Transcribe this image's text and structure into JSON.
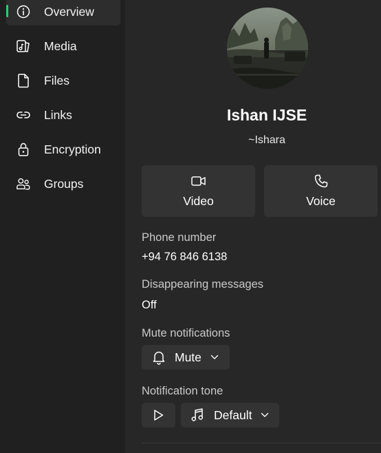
{
  "sidebar": {
    "items": [
      {
        "label": "Overview",
        "icon": "info-icon"
      },
      {
        "label": "Media",
        "icon": "media-icon"
      },
      {
        "label": "Files",
        "icon": "file-icon"
      },
      {
        "label": "Links",
        "icon": "link-icon"
      },
      {
        "label": "Encryption",
        "icon": "lock-icon"
      },
      {
        "label": "Groups",
        "icon": "groups-icon"
      }
    ],
    "active": "Overview"
  },
  "profile": {
    "name": "Ishan IJSE",
    "subname": "~Ishara"
  },
  "actions": {
    "video_label": "Video",
    "voice_label": "Voice"
  },
  "phone": {
    "label": "Phone number",
    "value": "+94 76 846 6138"
  },
  "disappearing": {
    "label": "Disappearing messages",
    "value": "Off"
  },
  "mute": {
    "label": "Mute notifications",
    "button_label": "Mute"
  },
  "tone": {
    "label": "Notification tone",
    "select_label": "Default"
  },
  "colors": {
    "accent": "#25d366",
    "sidebar_bg": "#202020",
    "main_bg": "#272727",
    "button_bg": "#333333"
  }
}
